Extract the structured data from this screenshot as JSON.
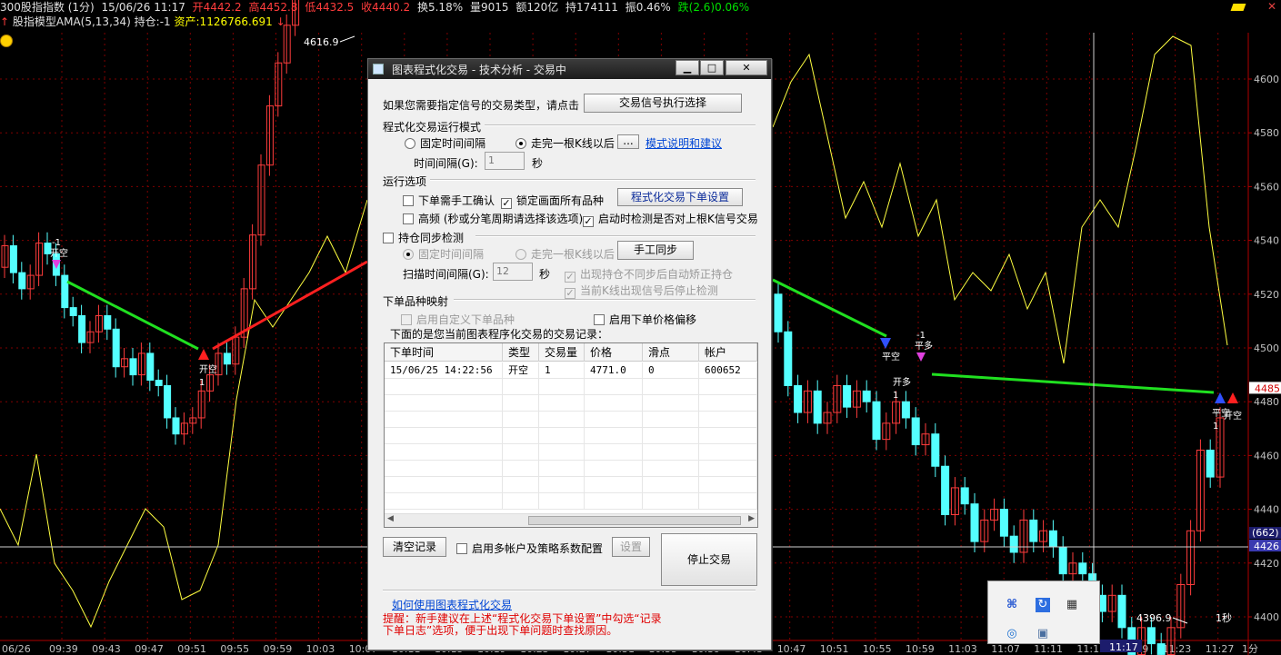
{
  "header": {
    "symbol": "300股指指数 (1分)",
    "datetime": "15/06/26 11:17",
    "open": "开4442.2",
    "high": "高4452.8",
    "low": "低4432.5",
    "close": "收4440.2",
    "turnover_rate": "换5.18%",
    "volume": "量9015",
    "amount": "额120亿",
    "open_interest": "持174111",
    "amplitude": "振0.46%",
    "change": "跌(2.6)0.06%"
  },
  "indicator_line": {
    "model": "股指模型AMA(5,13,34)",
    "position": "持仓:-1",
    "assets": "资产:1126766.691"
  },
  "chart": {
    "price_ticks": [
      "4600",
      "4580",
      "4560",
      "4540",
      "4520",
      "4500",
      "4480",
      "4460",
      "4440",
      "4420",
      "4400"
    ],
    "time_ticks": [
      "06/26",
      "09:39",
      "09:43",
      "09:47",
      "09:51",
      "09:55",
      "09:59",
      "10:03",
      "10:07",
      "10:11",
      "10:15",
      "10:19",
      "10:23",
      "10:27",
      "10:31",
      "10:35",
      "10:39",
      "10:43",
      "10:47",
      "10:51",
      "10:55",
      "10:59",
      "11:03",
      "11:07",
      "11:11",
      "11:15",
      "11:19",
      "11:23",
      "11:27",
      "1分"
    ],
    "high_label": "4616.9",
    "low_label": "4396.9",
    "current_price": "4485",
    "crosshair_price": "4426",
    "crosshair_count": "(662)",
    "cursor_time": "11:17",
    "interval_label": "1秒",
    "signals": {
      "open_short": "开空",
      "open_long": "开多",
      "close_short": "平空",
      "close_long": "平多",
      "minus_one": "-1",
      "one": "1"
    },
    "colors": {
      "up_candle": "#ff3c3c",
      "down_candle": "#54ffff",
      "ama_line_up": "#ff2020",
      "ama_line_down": "#20e020",
      "yellow_line": "#ffff40",
      "grid": "#800000"
    }
  },
  "dialog": {
    "title": "图表程式化交易 - 技术分析 - 交易中",
    "signal_type_prompt": "如果您需要指定信号的交易类型，请点击",
    "signal_type_button": "交易信号执行选择",
    "mode_group": "程式化交易运行模式",
    "mode_fixed_interval": "固定时间间隔",
    "mode_after_bar": "走完一根K线以后",
    "ellipsis_button": "...",
    "mode_help_link": "模式说明和建议",
    "interval_label": "时间间隔(G):",
    "interval_value": "1",
    "seconds": "秒",
    "options_group": "运行选项",
    "opt_manual_confirm": "下单需手工确认",
    "opt_lock_all": "锁定画面所有品种",
    "order_settings_button": "程式化交易下单设置",
    "opt_high_freq": "高频 (秒或分笔周期请选择该选项)",
    "opt_check_last_signal": "启动时检测是否对上根K信号交易",
    "sync_group": "持仓同步检测",
    "sync_fixed_interval": "固定时间间隔",
    "sync_after_bar": "走完一根K线以后",
    "manual_sync_button": "手工同步",
    "scan_interval_label": "扫描时间间隔(G):",
    "scan_interval_value": "12",
    "sync_auto_correct": "出现持仓不同步后自动矫正持仓",
    "sync_stop_check": "当前K线出现信号后停止检测",
    "mapping_group": "下单品种映射",
    "mapping_custom": "启用自定义下单品种",
    "mapping_price_offset": "启用下单价格偏移",
    "records_caption": "下面的是您当前图表程序化交易的交易记录：",
    "columns": [
      "下单时间",
      "类型",
      "交易量",
      "价格",
      "滑点",
      "帐户"
    ],
    "rows": [
      [
        "15/06/25 14:22:56",
        "开空",
        "1",
        "4771.0",
        "0",
        "600652"
      ]
    ],
    "clear_button": "清空记录",
    "multi_account": "启用多帐户及策略系数配置",
    "settings_button": "设置",
    "stop_button": "停止交易",
    "help_link": "如何使用图表程式化交易",
    "tip": "提醒：新手建议在上述“程式化交易下单设置”中勾选“记录下单日志”选项，便于出现下单问题时查找原因。",
    "tip_line1": "提醒：新手建议在上述“程式化交易下单设置”中勾选“记录",
    "tip_line2": "下单日志”选项，便于出现下单问题时查找原因。"
  }
}
